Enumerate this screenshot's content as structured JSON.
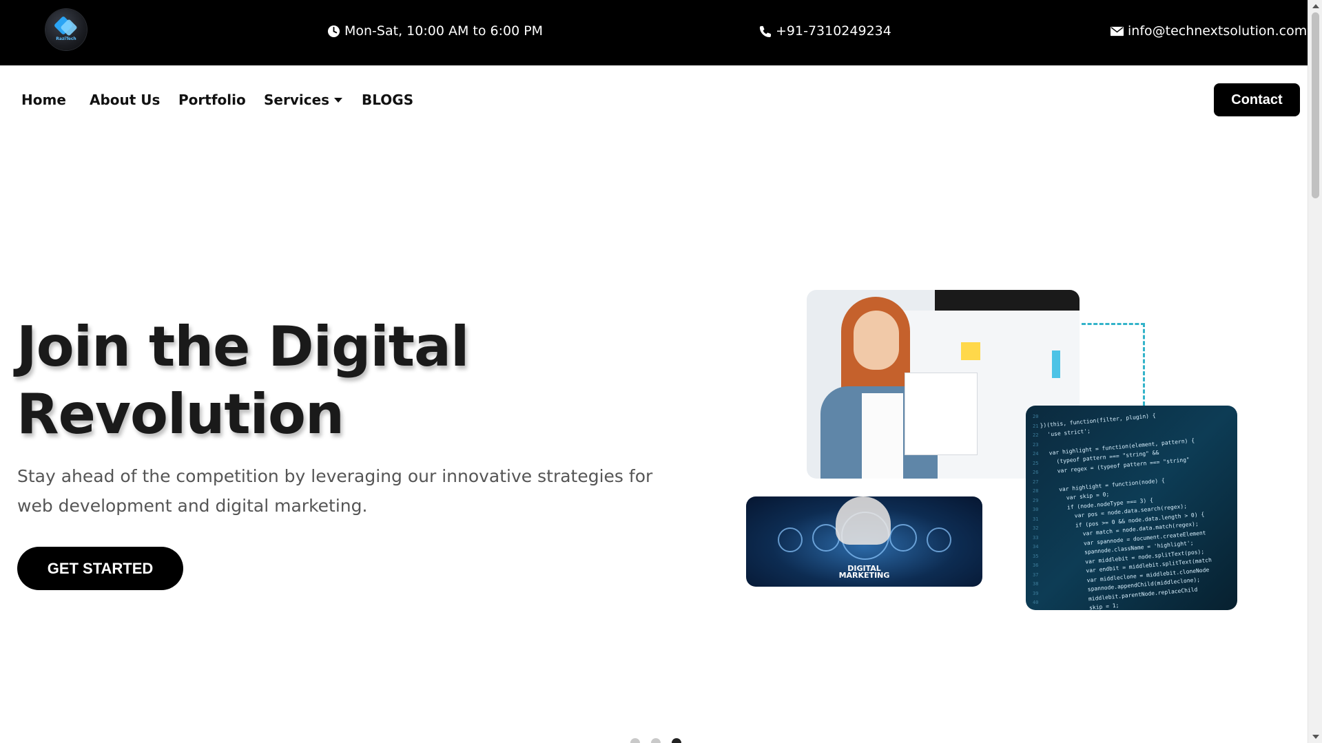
{
  "topbar": {
    "logo_text": "RaziTech",
    "hours": "Mon-Sat, 10:00 AM to 6:00 PM",
    "phone": "+91-7310249234",
    "email": "info@technextsolution.com"
  },
  "nav": {
    "items": [
      {
        "label": "Home"
      },
      {
        "label": "About Us"
      },
      {
        "label": "Portfolio"
      },
      {
        "label": "Services"
      },
      {
        "label": "BLOGS"
      }
    ],
    "contact_label": "Contact"
  },
  "hero": {
    "title_line1": "Join the Digital",
    "title_line2": "Revolution",
    "subtitle": "Stay ahead of the competition by leveraging our innovative strategies for web development and digital marketing.",
    "cta_label": "GET STARTED",
    "dm_label_line1": "DIGITAL",
    "dm_label_line2": "MARKETING"
  },
  "carousel": {
    "active_index": 2,
    "count": 3
  },
  "colors": {
    "topbar_bg": "#000000",
    "button_bg": "#000000",
    "accent_dash": "#33b3c9"
  }
}
